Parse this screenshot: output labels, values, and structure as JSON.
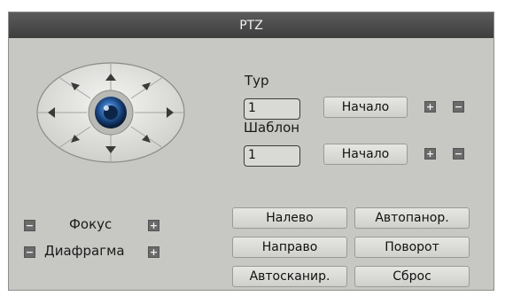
{
  "window": {
    "title": "PTZ"
  },
  "tour": {
    "label": "Тур",
    "value": "1",
    "start_label": "Начало",
    "add_symbol": "+",
    "remove_symbol": "−"
  },
  "pattern": {
    "label": "Шаблон",
    "value": "1",
    "start_label": "Начало",
    "add_symbol": "+",
    "remove_symbol": "−"
  },
  "focus": {
    "label": "Фокус",
    "minus_symbol": "−",
    "plus_symbol": "+"
  },
  "iris": {
    "label": "Диафрагма",
    "minus_symbol": "−",
    "plus_symbol": "+"
  },
  "actions": {
    "left": "Налево",
    "right": "Направо",
    "autoscan": "Автосканир.",
    "autopan": "Автопанор.",
    "rotate": "Поворот",
    "reset": "Сброс"
  },
  "ptz_pad": {
    "center_icon": "camera-lens-icon",
    "arrow_icon": "triangle-arrow-icon"
  }
}
